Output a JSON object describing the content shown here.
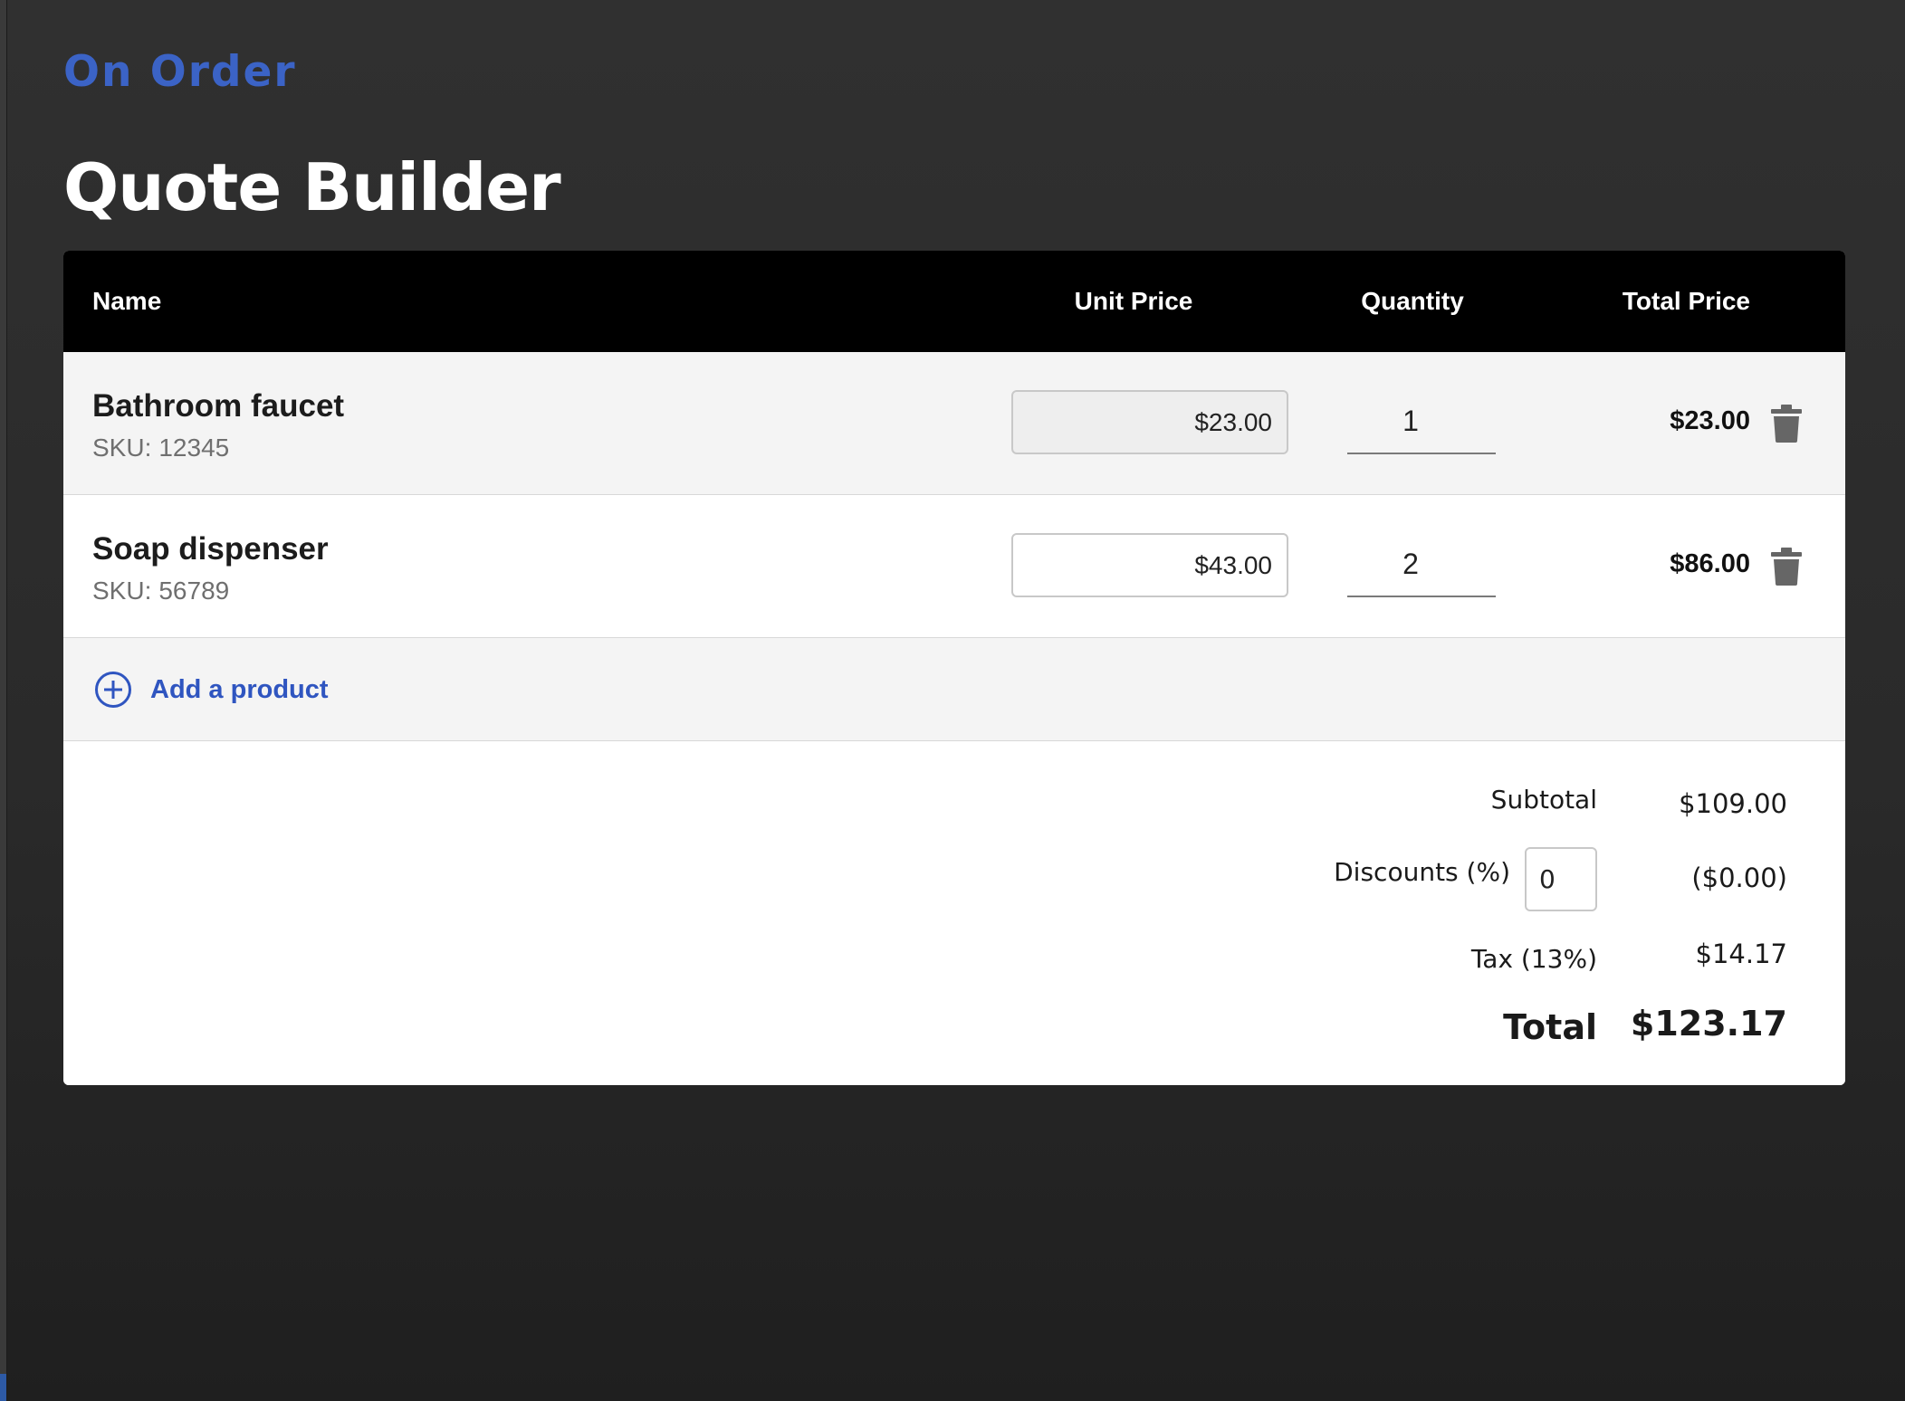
{
  "app": {
    "brand": "On Order",
    "page_title": "Quote Builder"
  },
  "table": {
    "headers": {
      "name": "Name",
      "unit_price": "Unit Price",
      "quantity": "Quantity",
      "total_price": "Total Price"
    },
    "rows": [
      {
        "name": "Bathroom faucet",
        "sku_prefix": "SKU:",
        "sku": "12345",
        "unit_price": "$23.00",
        "quantity": "1",
        "total": "$23.00",
        "delete_icon": "trash-icon"
      },
      {
        "name": "Soap dispenser",
        "sku_prefix": "SKU:",
        "sku": "56789",
        "unit_price": "$43.00",
        "quantity": "2",
        "total": "$86.00",
        "delete_icon": "trash-icon"
      }
    ],
    "add_product_label": "Add a product",
    "add_product_icon": "plus-circle-icon"
  },
  "summary": {
    "subtotal_label": "Subtotal",
    "subtotal_value": "$109.00",
    "discount_label": "Discounts (%)",
    "discount_input": "0",
    "discount_value": "($0.00)",
    "tax_label": "Tax (13%)",
    "tax_value": "$14.17",
    "total_label": "Total",
    "total_value": "$123.17"
  },
  "colors": {
    "brand_blue": "#3b63c6",
    "link_blue": "#2f55c0",
    "header_black": "#000000",
    "row_shade": "#f4f4f4"
  }
}
